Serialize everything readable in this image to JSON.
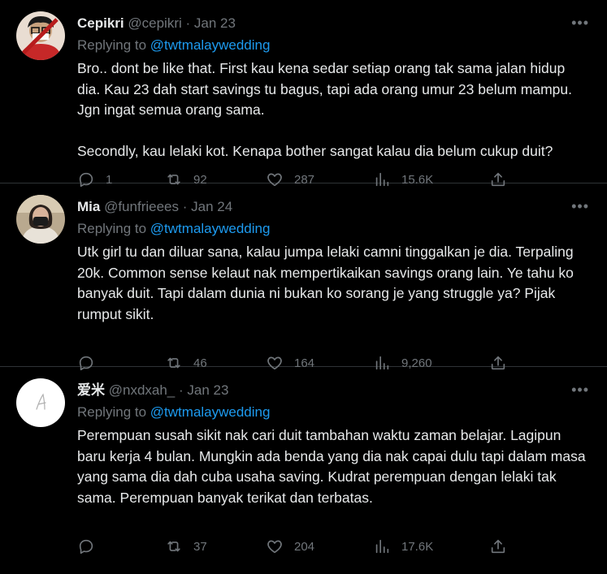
{
  "tweets": [
    {
      "name": "Cepikri",
      "handle": "@cepikri",
      "separator": "·",
      "date": "Jan 23",
      "more": "•••",
      "replying_prefix": "Replying to",
      "replying_to": "@twtmalaywedding",
      "paragraphs": [
        "Bro.. dont be like that. First kau kena sedar setiap orang tak sama jalan hidup dia. Kau 23 dah start savings tu bagus, tapi ada orang umur 23 belum mampu. Jgn ingat semua orang sama.",
        "Secondly, kau lelaki kot. Kenapa bother sangat kalau dia belum cukup duit?"
      ],
      "replies": "1",
      "retweets": "92",
      "likes": "287",
      "views": "15.6K"
    },
    {
      "name": "Mia",
      "handle": "@funfrieees",
      "separator": "·",
      "date": "Jan 24",
      "more": "•••",
      "replying_prefix": "Replying to",
      "replying_to": "@twtmalaywedding",
      "paragraphs": [
        "Utk girl tu dan diluar sana, kalau jumpa lelaki camni tinggalkan je dia. Terpaling 20k. Common sense kelaut nak mempertikaikan savings orang lain. Ye tahu ko banyak duit. Tapi dalam dunia ni bukan ko sorang je yang struggle ya? Pijak rumput sikit."
      ],
      "replies": "",
      "retweets": "46",
      "likes": "164",
      "views": "9,260"
    },
    {
      "name": "爱米",
      "handle": "@nxdxah_",
      "separator": "·",
      "date": "Jan 23",
      "more": "•••",
      "replying_prefix": "Replying to",
      "replying_to": "@twtmalaywedding",
      "paragraphs": [
        "Perempuan susah sikit nak cari duit tambahan waktu zaman belajar. Lagipun baru kerja 4 bulan. Mungkin ada benda yang dia nak capai dulu tapi dalam masa yang sama dia dah cuba usaha saving. Kudrat perempuan dengan lelaki tak sama. Perempuan banyak terikat dan terbatas."
      ],
      "replies": "",
      "retweets": "37",
      "likes": "204",
      "views": "17.6K"
    }
  ],
  "icons": {
    "reply": "comment-icon",
    "retweet": "retweet-icon",
    "like": "heart-icon",
    "views": "views-icon",
    "share": "share-icon",
    "more": "more-icon"
  },
  "colors": {
    "background": "#000000",
    "text": "#e7e9ea",
    "muted": "#71767b",
    "link": "#1d9bf0",
    "divider": "#2f3336"
  }
}
